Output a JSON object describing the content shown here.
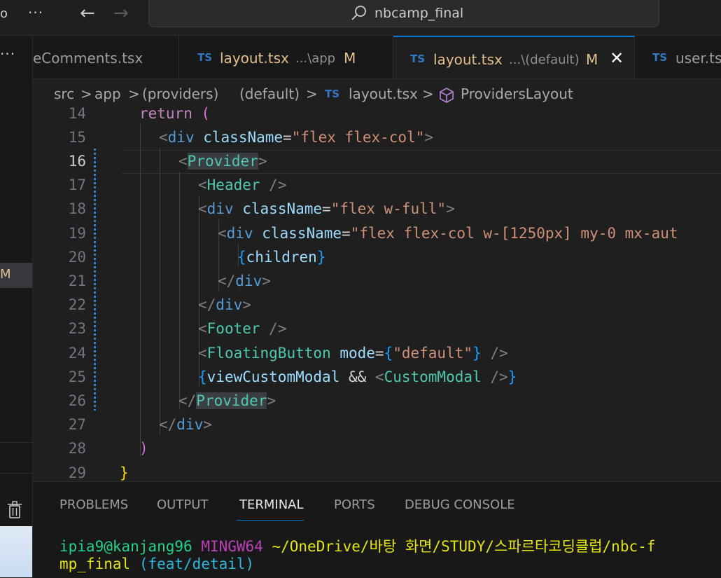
{
  "titlebar": {
    "edge_glyph": "o",
    "more": "···",
    "back": "←",
    "forward": "→",
    "search_text": "nbcamp_final"
  },
  "left_strip": {
    "more": "···",
    "modified_badge": "M"
  },
  "tabs": [
    {
      "label": "eComments.tsx",
      "path": "",
      "modified": "",
      "active": false
    },
    {
      "icon": "TS",
      "label": "layout.tsx",
      "path": "...\\app",
      "modified": "M",
      "active": false
    },
    {
      "icon": "TS",
      "label": "layout.tsx",
      "path": "...\\(default)",
      "modified": "M",
      "active": true,
      "close": "✕"
    },
    {
      "icon": "TS",
      "label": "user.ts",
      "path": "",
      "modified": "",
      "active": false
    }
  ],
  "breadcrumb": {
    "items": [
      "src",
      "app",
      "(providers)",
      "(default)"
    ],
    "separator": ">",
    "file_icon": "TS",
    "file": "layout.tsx",
    "symbol": "ProvidersLayout"
  },
  "editor": {
    "line_numbers": [
      "14",
      "15",
      "16",
      "17",
      "18",
      "19",
      "20",
      "21",
      "22",
      "23",
      "24",
      "25",
      "26",
      "27",
      "28",
      "29"
    ],
    "current_line": "16",
    "code": {
      "l14_kw": "return",
      "l14_paren": "(",
      "l15_tag": "div",
      "l15_attr": "className",
      "l15_str": "\"flex flex-col\"",
      "l16_comp": "Provider",
      "l17_comp": "Header",
      "l18_tag": "div",
      "l18_attr": "className",
      "l18_str": "\"flex w-full\"",
      "l19_tag": "div",
      "l19_attr": "className",
      "l19_str": "\"flex flex-col w-[1250px] my-0 mx-aut",
      "l20_var": "children",
      "l21_tag": "div",
      "l22_tag": "div",
      "l23_comp": "Footer",
      "l24_comp": "FloatingButton",
      "l24_attr": "mode",
      "l24_str": "\"default\"",
      "l25_var": "viewCustomModal",
      "l25_op": "&&",
      "l25_comp": "CustomModal",
      "l26_comp": "Provider",
      "l27_tag": "div",
      "l28_paren": ")",
      "l29_brace": "}"
    }
  },
  "panel": {
    "tabs": [
      "PROBLEMS",
      "OUTPUT",
      "TERMINAL",
      "PORTS",
      "DEBUG CONSOLE"
    ],
    "active_tab": "TERMINAL",
    "terminal": {
      "user_host": "ipia9@kanjang96",
      "shell": "MINGW64",
      "path_line1": "~/OneDrive/바탕 화면/STUDY/스파르타코딩클럽/nbc-f",
      "path_line2": "mp_final",
      "branch": "(feat/detail)"
    }
  },
  "colors": {
    "accent": "#0078d4",
    "ts_icon": "#3178c6",
    "modified": "#e2c08d",
    "background": "#1f1f1f"
  }
}
